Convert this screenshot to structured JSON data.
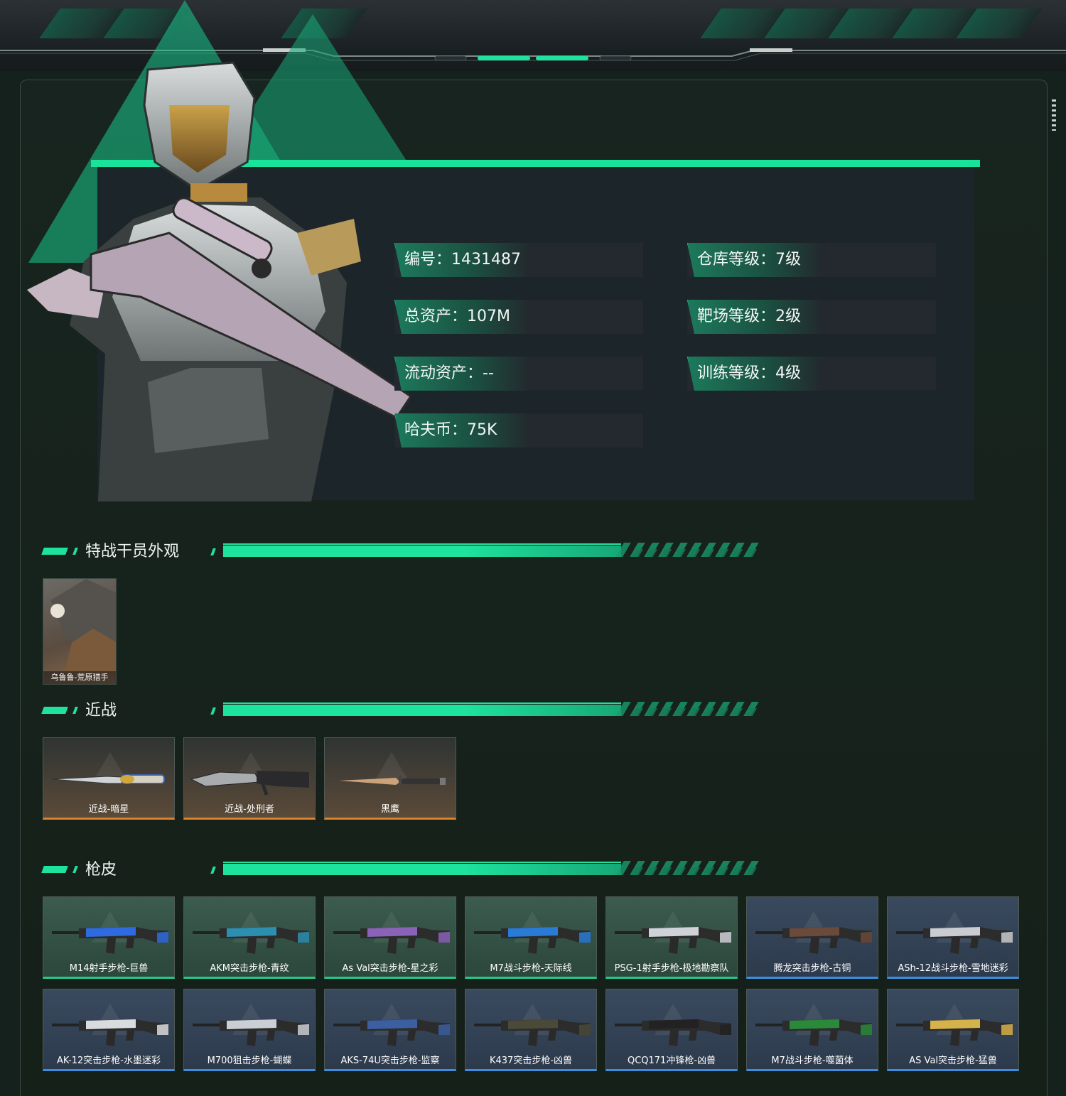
{
  "colors": {
    "accent": "#1ee39f",
    "panel": "#152019",
    "green_rarity": "#25c98a",
    "blue_rarity": "#3c8fe0",
    "orange_rarity": "#d9822d"
  },
  "profile": {
    "stats": [
      {
        "text": "编号：1431487"
      },
      {
        "text": "仓库等级：7级"
      },
      {
        "text": "总资产：107M"
      },
      {
        "text": "靶场等级：2级"
      },
      {
        "text": "流动资产：--"
      },
      {
        "text": "训练等级：4级"
      },
      {
        "text": "哈夫币：75K"
      }
    ]
  },
  "sections": {
    "operator_skins": {
      "title": "特战干员外观",
      "items": [
        {
          "label": "乌鲁鲁-荒原猎手"
        }
      ]
    },
    "melee": {
      "title": "近战",
      "items": [
        {
          "label": "近战-暗星",
          "rarity": "orange"
        },
        {
          "label": "近战-处刑者",
          "rarity": "orange"
        },
        {
          "label": "黑鹰",
          "rarity": "orange"
        }
      ]
    },
    "gun_skins": {
      "title": "枪皮",
      "items": [
        {
          "label": "M14射手步枪-巨兽",
          "rarity": "green"
        },
        {
          "label": "AKM突击步枪-青纹",
          "rarity": "green"
        },
        {
          "label": "As Val突击步枪-星之彩",
          "rarity": "green"
        },
        {
          "label": "M7战斗步枪-天际线",
          "rarity": "green"
        },
        {
          "label": "PSG-1射手步枪-极地勘察队",
          "rarity": "green"
        },
        {
          "label": "腾龙突击步枪-古铜",
          "rarity": "blue"
        },
        {
          "label": "ASh-12战斗步枪-雪地迷彩",
          "rarity": "blue"
        },
        {
          "label": "AK-12突击步枪-水墨迷彩",
          "rarity": "blue"
        },
        {
          "label": "M700狙击步枪-蝴蝶",
          "rarity": "blue"
        },
        {
          "label": "AKS-74U突击步枪-监察",
          "rarity": "blue"
        },
        {
          "label": "K437突击步枪-凶兽",
          "rarity": "blue"
        },
        {
          "label": "QCQ171冲锋枪-凶兽",
          "rarity": "blue"
        },
        {
          "label": "M7战斗步枪-噬菌体",
          "rarity": "blue"
        },
        {
          "label": "AS Val突击步枪-猛兽",
          "rarity": "blue"
        }
      ]
    }
  }
}
